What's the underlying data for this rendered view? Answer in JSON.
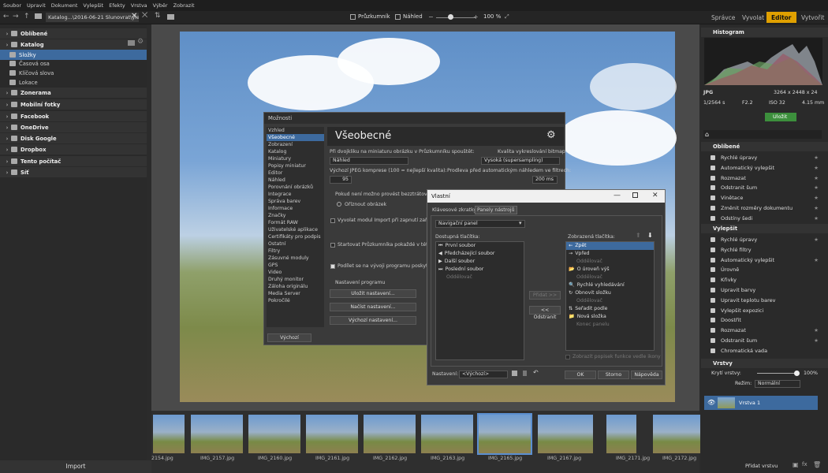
{
  "menu": [
    "Soubor",
    "Upravit",
    "Dokument",
    "Vylepšit",
    "Efekty",
    "Vrstva",
    "Výběr",
    "Zobrazit"
  ],
  "toolbar": {
    "path": "Katalog...\\2016-06-21 Slunovrat\\ylet",
    "explorer": "Průzkumník",
    "preview": "Náhled",
    "zoom": "100 %"
  },
  "modes": [
    "Správce",
    "Vyvolat",
    "Editor",
    "Vytvořit"
  ],
  "left": {
    "items": [
      {
        "label": "Oblíbené",
        "type": "head"
      },
      {
        "label": "Katalog",
        "type": "head"
      },
      {
        "label": "Složky",
        "type": "sel"
      },
      {
        "label": "Časová osa",
        "type": "sub"
      },
      {
        "label": "Klíčová slova",
        "type": "sub"
      },
      {
        "label": "Lokace",
        "type": "sub"
      },
      {
        "label": "Zonerama",
        "type": "head"
      },
      {
        "label": "Mobilní fotky",
        "type": "head"
      },
      {
        "label": "Facebook",
        "type": "head"
      },
      {
        "label": "OneDrive",
        "type": "head"
      },
      {
        "label": "Disk Google",
        "type": "head"
      },
      {
        "label": "Dropbox",
        "type": "head"
      },
      {
        "label": "Tento počítač",
        "type": "head"
      },
      {
        "label": "Síť",
        "type": "head"
      }
    ],
    "import": "Import"
  },
  "strip": [
    {
      "name": "2154.jpg"
    },
    {
      "name": "IMG_2157.jpg"
    },
    {
      "name": "IMG_2160.jpg"
    },
    {
      "name": "IMG_2161.jpg"
    },
    {
      "name": "IMG_2162.jpg"
    },
    {
      "name": "IMG_2163.jpg"
    },
    {
      "name": "IMG_2165.jpg"
    },
    {
      "name": "IMG_2167.jpg"
    },
    {
      "name": "IMG_2171.jpg"
    },
    {
      "name": "IMG_2172.jpg"
    }
  ],
  "right": {
    "histogram": "Histogram",
    "format": "JPG",
    "dims": "3264 x 2448 x 24",
    "exif": [
      "1/2564 s",
      "F2.2",
      "ISO 32",
      "4.15 mm"
    ],
    "save": "Uložit",
    "fav_head": "Oblíbené",
    "fav": [
      "Rychlé úpravy",
      "Automatický vylepšit",
      "Rozmazat",
      "Odstranit šum",
      "Vinětace",
      "Změnit rozměry dokumentu",
      "Odstíny šedi"
    ],
    "imp_head": "Vylepšit",
    "imp": [
      "Rychlé úpravy",
      "Rychlé filtry",
      "Automatický vylepšit",
      "Úrovně",
      "Křivky",
      "Upravit barvy",
      "Upravit teplotu barev",
      "Vylepšit expozici",
      "Doostřit",
      "Rozmazat",
      "Odstranit šum",
      "Chromatická vada"
    ],
    "layers_head": "Vrstvy",
    "opacity_label": "Krytí vrstvy:",
    "opacity": "100%",
    "mode_label": "Režim:",
    "mode": "Normální",
    "layer": "Vrstva 1",
    "add_layer": "Přidat vrstvu"
  },
  "options": {
    "title": "Možnosti",
    "nav": [
      "Vzhled",
      "Všeobecné",
      "Zobrazení",
      "Katalog",
      "Miniatury",
      "Popisy miniatur",
      "Editor",
      "Náhled",
      "Porovnání obrázků",
      "Integrace",
      "Správa barev",
      "Informace",
      "Značky",
      "Formát RAW",
      "Uživatelské aplikace",
      "Certifikáty pro podpis",
      "Ostatní",
      "Filtry",
      "Zásuvné moduly",
      "GPS",
      "Video",
      "Druhý monitor",
      "Záloha originálu",
      "Media Server",
      "Pokročilé"
    ],
    "heading": "Všeobecné",
    "dbl_label": "Při dvojkliku na miniaturu obrázku v Průzkumníku spouštět:",
    "dbl_value": "Náhled",
    "quality_label": "Kvalita vykreslování bitmap:",
    "quality_value": "Vysoká (supersampling)",
    "jpeg_label": "Výchozí JPEG komprese (100 = nejlepší kvalita):",
    "jpeg_value": "95",
    "delay_label": "Prodleva před automatickým náhledem ve filtrech:",
    "delay_value": "200 ms",
    "zero_label": "Pokud není možno provést bezztrátovou",
    "crop": "Oříznout obrázek",
    "import_chk": "Vyvolat modul Import při zapnutí zařízení",
    "start_chk": "Startovat Průzkumníka pokaždé v této složce",
    "dev_chk": "Podílet se na vývoji programu poskytnutím",
    "settings": "Nastavení programu",
    "save_btn": "Uložit nastavení...",
    "load_btn": "Načíst nastavení...",
    "default_btn": "Výchozí nastavení...",
    "reset": "Výchozí"
  },
  "custom": {
    "title": "Vlastní",
    "tab1": "Klávesové zkratky",
    "tab2": "Panely nástrojů",
    "panel": "Navigační panel",
    "avail_label": "Dostupná tlačítka:",
    "avail": [
      "První soubor",
      "Předcházející soubor",
      "Další soubor",
      "Poslední soubor",
      "Oddělovač"
    ],
    "shown_label": "Zobrazená tlačítka:",
    "shown": [
      "Zpět",
      "Vpřed",
      "Oddělovač",
      "O úroveň výš",
      "Oddělovač",
      "Rychlé vyhledávání",
      "Obnovit složku",
      "Oddělovač",
      "Seřadit podle",
      "Nová složka",
      "Konec panelu"
    ],
    "add": "Přidat >>",
    "remove": "<< Odstranit",
    "show_text": "Zobrazit popisek funkce vedle ikony",
    "setting_label": "Nastavení:",
    "setting_value": "<Výchozí>",
    "ok": "OK",
    "cancel": "Storno",
    "help": "Nápověda"
  }
}
